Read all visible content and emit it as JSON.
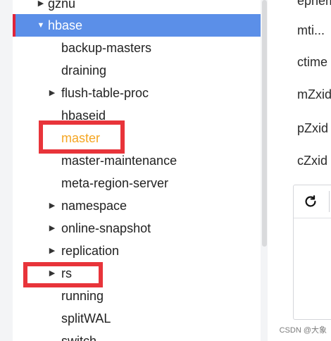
{
  "tree": {
    "top_item": "gznu",
    "selected_item": "hbase",
    "children": [
      {
        "label": "backup-masters",
        "expandable": false
      },
      {
        "label": "draining",
        "expandable": false
      },
      {
        "label": "flush-table-proc",
        "expandable": true
      },
      {
        "label": "hbaseid",
        "expandable": false
      },
      {
        "label": "master",
        "expandable": false
      },
      {
        "label": "master-maintenance",
        "expandable": false
      },
      {
        "label": "meta-region-server",
        "expandable": false
      },
      {
        "label": "namespace",
        "expandable": true
      },
      {
        "label": "online-snapshot",
        "expandable": true
      },
      {
        "label": "replication",
        "expandable": true
      },
      {
        "label": "rs",
        "expandable": true
      },
      {
        "label": "running",
        "expandable": false
      },
      {
        "label": "splitWAL",
        "expandable": false
      },
      {
        "label": "switch",
        "expandable": false
      }
    ]
  },
  "details": {
    "props": [
      "ephem",
      "mti...",
      "ctime",
      "mZxid",
      "pZxid",
      "cZxid"
    ]
  },
  "icons": {
    "expand": "▶",
    "collapse": "▼",
    "refresh": "refresh-icon"
  },
  "colors": {
    "selected_bg": "#5b8fe8",
    "selected_marker": "#e0243a",
    "highlight_label": "#f5a623",
    "annotation_box": "#e8343a"
  },
  "watermark": "CSDN @大象"
}
